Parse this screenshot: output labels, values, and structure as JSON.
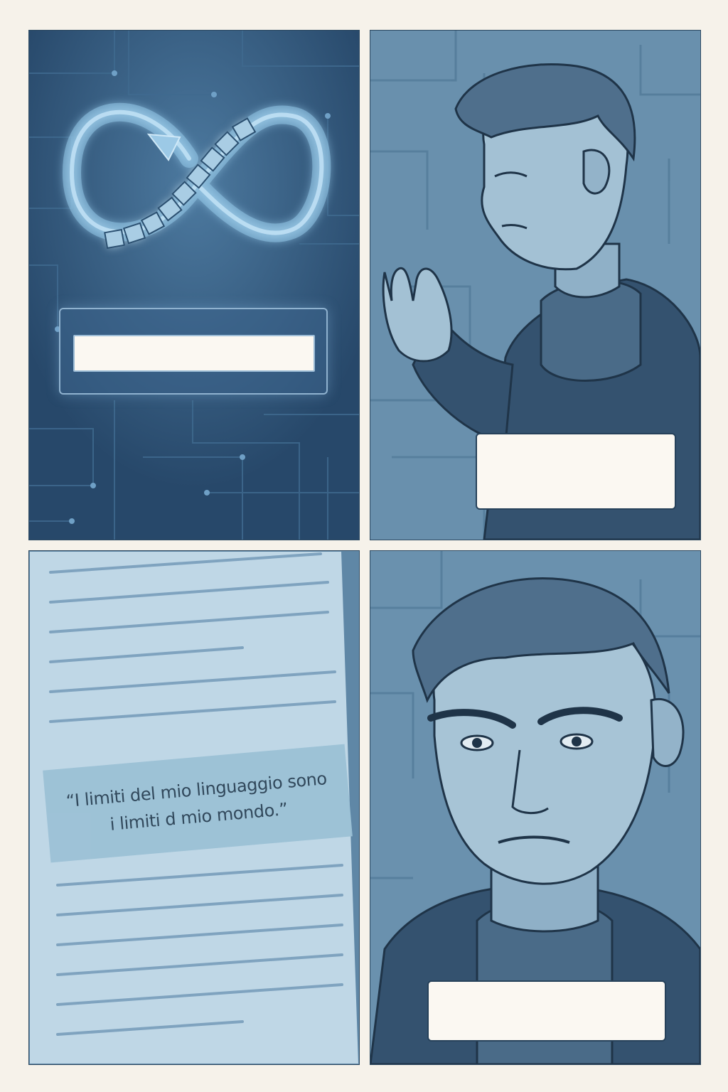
{
  "panels": [
    {
      "id": "panel-1",
      "caption": ""
    },
    {
      "id": "panel-2",
      "caption": ""
    },
    {
      "id": "panel-3",
      "quote": "“I limiti del mio linguaggio sono i limiti d mio mondo.”"
    },
    {
      "id": "panel-4",
      "caption": ""
    }
  ],
  "icons": [
    "infinity-loop-icon",
    "arrow-icon"
  ],
  "colors": {
    "page_background": "#f6f2ea",
    "panel_dark": "#2f5273",
    "panel_mid": "#5f87a6",
    "caption_box": "#fbf8f2",
    "quote_highlight": "#9cc1d6",
    "glow": "#8fc4e6"
  }
}
